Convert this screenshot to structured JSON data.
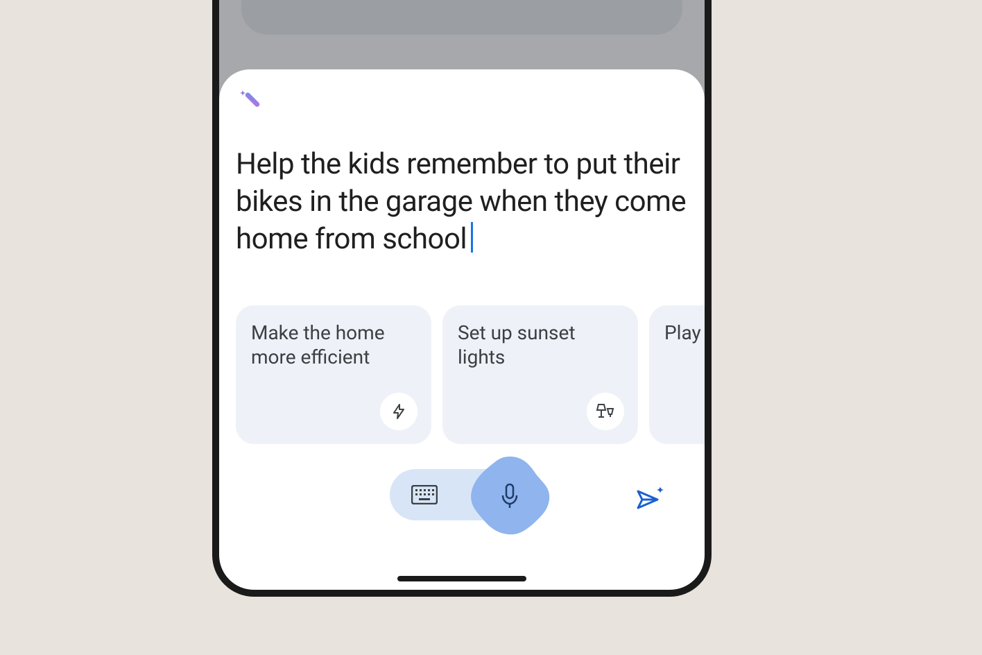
{
  "prompt": {
    "text": "Help the kids remember to put their bikes in the garage when they come home from school"
  },
  "suggestions": [
    {
      "label": "Make the home more efficient",
      "icon": "bolt"
    },
    {
      "label": "Set up sunset lights",
      "icon": "lamp"
    },
    {
      "label": "Play sounds when",
      "icon": "play"
    }
  ],
  "icons": {
    "magic": "magic-wand-icon",
    "keyboard": "keyboard-icon",
    "mic": "mic-icon",
    "send": "send-icon"
  }
}
